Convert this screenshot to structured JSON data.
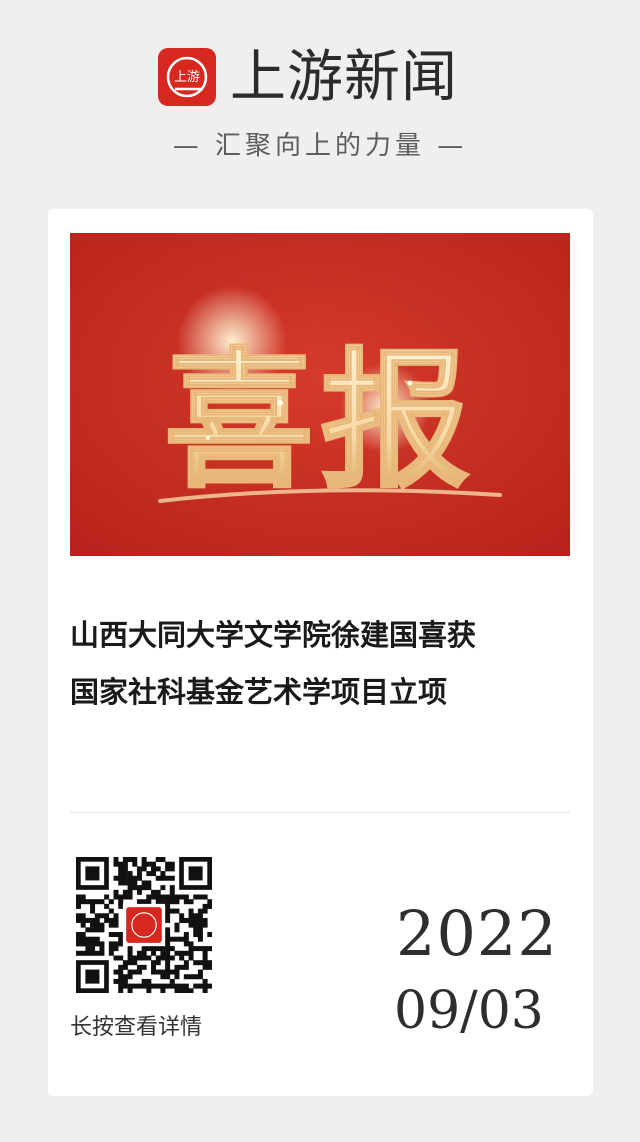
{
  "header": {
    "brand_name": "上游新闻",
    "logo_text": "上游",
    "slogan": "— 汇聚向上的力量 —"
  },
  "card": {
    "banner": {
      "title": "喜报",
      "colors": {
        "background": "#c62b20",
        "calligraphy": "#f6d9a4"
      }
    },
    "headline": {
      "lines": [
        "山西大同大学文学院徐建国喜获",
        "国家社科基金艺术学项目立项"
      ]
    },
    "qr_code": {
      "icon": "qr-code-icon",
      "caption": "长按查看详情"
    },
    "date": {
      "year": "2022",
      "month_day": "09/03"
    }
  },
  "colors": {
    "brand_red": "#d7281f",
    "page_background": "#efefef",
    "card_background": "#ffffff"
  }
}
